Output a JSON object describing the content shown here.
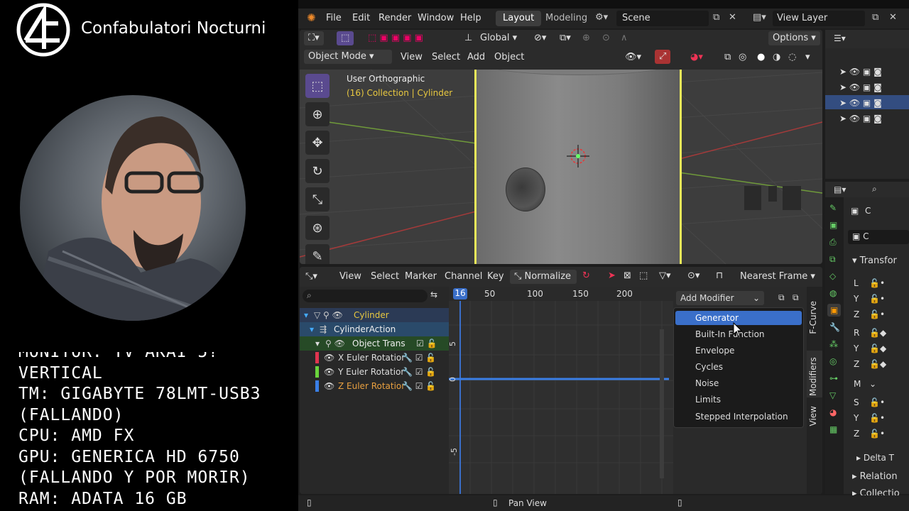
{
  "overlay": {
    "channel_name": "Confabulatori Nocturni",
    "specs": [
      "MONITOR: TV AKAI 5?",
      "VERTICAL",
      "TM: GIGABYTE 78LMT-USB3",
      "(FALLANDO)",
      "CPU: AMD FX",
      "GPU: GENERICA HD 6750",
      "(FALLANDO Y POR MORIR)",
      "RAM: ADATA 16 GB"
    ]
  },
  "topbar": {
    "menus": [
      "File",
      "Edit",
      "Render",
      "Window",
      "Help"
    ],
    "workspaces": [
      "Layout",
      "Modeling"
    ],
    "scene": "Scene",
    "view_layer": "View Layer"
  },
  "viewport": {
    "transform_orientation": "Global",
    "options_label": "Options",
    "mode": "Object Mode",
    "menus": [
      "View",
      "Select",
      "Add",
      "Object"
    ],
    "view_name": "User Orthographic",
    "collection_info": "(16) Collection | Cylinder"
  },
  "graph_editor": {
    "menus": [
      "View",
      "Select",
      "Marker",
      "Channel",
      "Key"
    ],
    "normalize_label": "Normalize",
    "frame_mode": "Nearest Frame",
    "current_frame": "16",
    "ruler": [
      "50",
      "100",
      "150",
      "200"
    ],
    "y_ticks": [
      "5",
      "0",
      "-5"
    ],
    "channels": [
      {
        "label": "Cylinder",
        "level": 0
      },
      {
        "label": "CylinderAction",
        "level": 1
      },
      {
        "label": "Object Trans",
        "level": 2
      },
      {
        "label": "X Euler Rotatior",
        "level": 3,
        "color": "#e0344f"
      },
      {
        "label": "Y Euler Rotatior",
        "level": 3,
        "color": "#6ad43c"
      },
      {
        "label": "Z Euler Rotatior",
        "level": 3,
        "color": "#3a7fe6"
      }
    ],
    "add_modifier_label": "Add Modifier",
    "modifier_options": [
      "Generator",
      "Built-In Function",
      "Envelope",
      "Cycles",
      "Noise",
      "Limits",
      "Stepped Interpolation"
    ],
    "sidebar_tabs": [
      "F-Curve",
      "Modifiers",
      "View"
    ]
  },
  "properties": {
    "name_field": "C",
    "object_field": "C",
    "transform_label": "Transfor",
    "axes_loc": [
      "L",
      "Y",
      "Z"
    ],
    "axes_rot": [
      "R",
      "Y",
      "Z"
    ],
    "mode_label": "M",
    "axes_scale": [
      "S",
      "Y",
      "Z"
    ],
    "delta_label": "Delta T",
    "relations_label": "Relation",
    "collections_label": "Collectio"
  },
  "status": {
    "pan_view": "Pan View"
  },
  "colors": {
    "selection": "#e8e85a",
    "accent_blue": "#3a6fc9",
    "active_tool": "#5a4a8f"
  }
}
